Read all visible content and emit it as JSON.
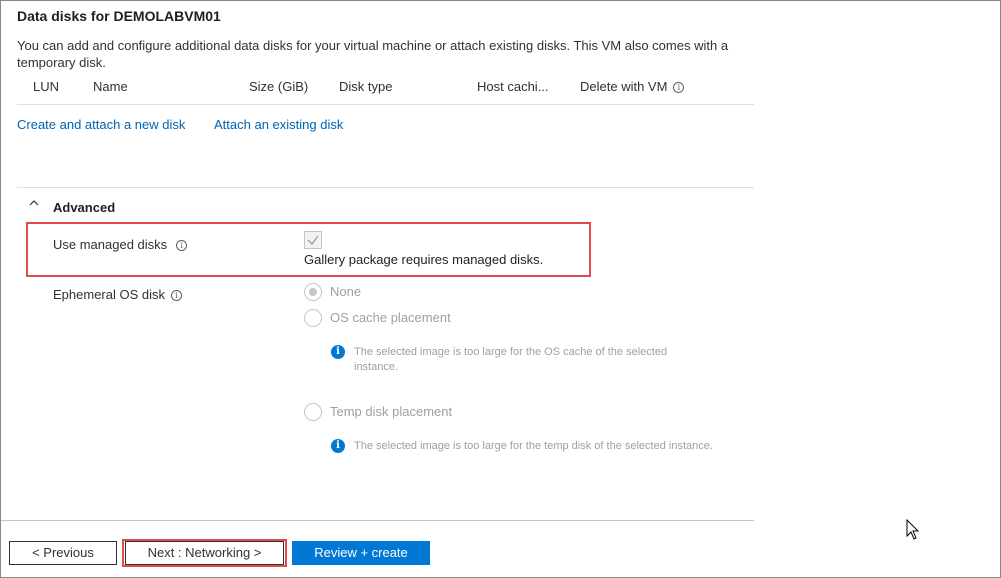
{
  "data_disks": {
    "title": "Data disks for DEMOLABVM01",
    "description": "You can add and configure additional data disks for your virtual machine or attach existing disks. This VM also comes with a temporary disk.",
    "columns": {
      "lun": "LUN",
      "name": "Name",
      "size": "Size (GiB)",
      "disk_type": "Disk type",
      "host_caching": "Host cachi...",
      "delete_with_vm": "Delete with VM"
    },
    "create_link": "Create and attach a new disk",
    "attach_link": "Attach an existing disk"
  },
  "advanced": {
    "section_title": "Advanced",
    "managed_disks_label": "Use managed disks",
    "managed_disks_checked": true,
    "managed_disks_note": "Gallery package requires managed disks.",
    "ephemeral_label": "Ephemeral OS disk",
    "options": {
      "none": "None",
      "os_cache": "OS cache placement",
      "temp_disk": "Temp disk placement"
    },
    "selected_option": "None",
    "os_cache_note": "The selected image is too large for the OS cache of the selected instance.",
    "temp_disk_note": "The selected image is too large for the temp disk of the selected instance."
  },
  "footer": {
    "previous": "< Previous",
    "next": "Next : Networking >",
    "review": "Review + create"
  },
  "colors": {
    "link": "#0063b1",
    "primary": "#0078d4",
    "highlight_box": "#e04b4b"
  }
}
